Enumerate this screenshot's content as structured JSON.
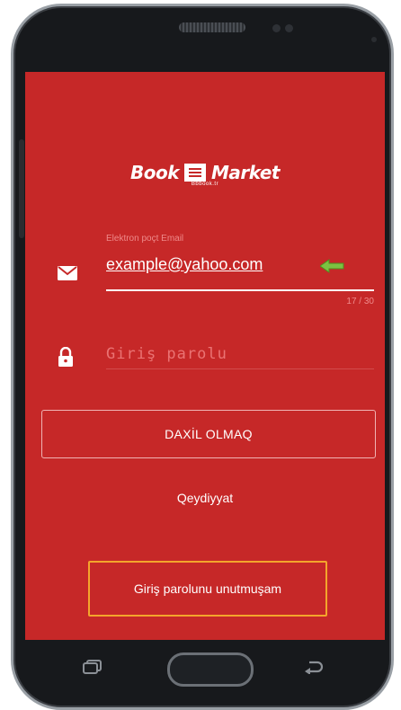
{
  "app": {
    "logo": {
      "text": "Book",
      "text2": "Market",
      "subtitle": "Bbbook.tr"
    },
    "accent_color": "#c62828",
    "highlight_color": "#f4a52c"
  },
  "email": {
    "label": "Elektron poçt Email",
    "value": "example@yahoo.com",
    "counter": "17 / 30",
    "icon": "mail-icon",
    "indicator_icon": "arrow-left-icon"
  },
  "password": {
    "placeholder": "Giriş parolu",
    "icon": "lock-icon"
  },
  "actions": {
    "login_label": "DAXİL OLMAQ",
    "register_label": "Qeydiyyat",
    "forgot_label": "Giriş parolunu unutmuşam"
  },
  "nav": {
    "recent": "recent-apps-icon",
    "home": "home-button",
    "back": "back-icon"
  }
}
